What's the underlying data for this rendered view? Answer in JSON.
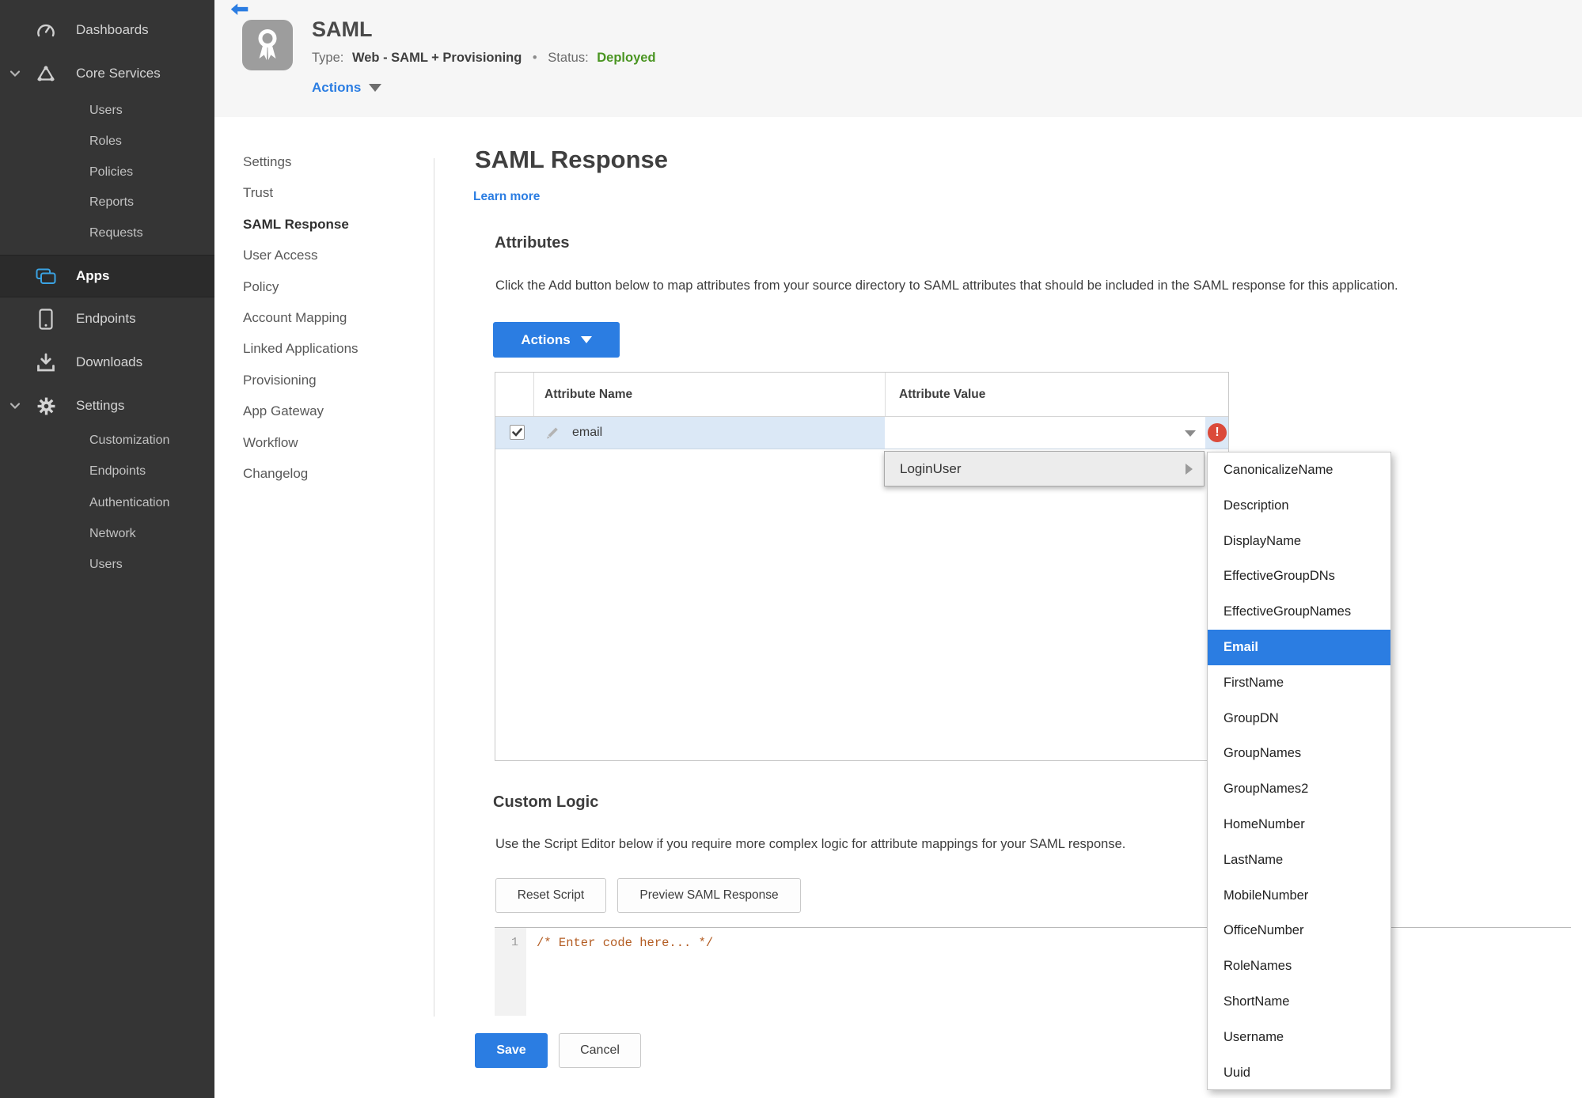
{
  "colors": {
    "accent_blue": "#2b7de2",
    "apps_icon_blue": "#3aa3e3",
    "status_green": "#4a9522",
    "error_red": "#db4a3a",
    "row_highlight": "#dbe8f6",
    "sidebar_bg": "#353535",
    "header_bg": "#f6f6f6",
    "code_comment_color": "#b35c22"
  },
  "icons": {
    "back": "back-arrow-icon",
    "app": "ribbon-badge-icon",
    "dashboards": "gauge-icon",
    "core_services": "network-triangle-icon",
    "apps": "stacked-windows-icon",
    "endpoints": "mobile-device-icon",
    "downloads": "download-tray-icon",
    "settings": "gear-icon",
    "row_edit": "pencil-icon",
    "error": "exclamation-circle-icon"
  },
  "sidebar": {
    "items": {
      "dashboards": {
        "label": "Dashboards"
      },
      "core_services": {
        "label": "Core Services",
        "children": [
          "Users",
          "Roles",
          "Policies",
          "Reports",
          "Requests"
        ]
      },
      "apps": {
        "label": "Apps",
        "active": true
      },
      "endpoints": {
        "label": "Endpoints"
      },
      "downloads": {
        "label": "Downloads"
      },
      "settings": {
        "label": "Settings",
        "children": [
          "Customization",
          "Endpoints",
          "Authentication",
          "Network",
          "Users"
        ]
      }
    }
  },
  "header": {
    "app_title": "SAML",
    "type_label": "Type:",
    "type_value": "Web - SAML + Provisioning",
    "separator": "•",
    "status_label": "Status:",
    "status_value": "Deployed",
    "actions_label": "Actions"
  },
  "app_nav": {
    "items": [
      {
        "label": "Settings"
      },
      {
        "label": "Trust"
      },
      {
        "label": "SAML Response",
        "state": "active"
      },
      {
        "label": "User Access"
      },
      {
        "label": "Policy"
      },
      {
        "label": "Account Mapping"
      },
      {
        "label": "Linked Applications"
      },
      {
        "label": "Provisioning"
      },
      {
        "label": "App Gateway"
      },
      {
        "label": "Workflow"
      },
      {
        "label": "Changelog"
      }
    ]
  },
  "main": {
    "title": "SAML Response",
    "learn_more": "Learn more",
    "attributes": {
      "heading": "Attributes",
      "description": "Click the Add button below to map attributes from your source directory to SAML attributes that should be included in the SAML response for this application.",
      "actions_button": "Actions",
      "table": {
        "columns": [
          "Attribute Name",
          "Attribute Value"
        ],
        "rows": [
          {
            "name": "email",
            "value": "",
            "checked": true,
            "error_glyph": "!"
          }
        ]
      }
    },
    "context_menu": {
      "parent": "LoginUser",
      "items": [
        {
          "label": "CanonicalizeName"
        },
        {
          "label": "Description"
        },
        {
          "label": "DisplayName"
        },
        {
          "label": "EffectiveGroupDNs"
        },
        {
          "label": "EffectiveGroupNames"
        },
        {
          "label": "Email",
          "state": "selected"
        },
        {
          "label": "FirstName"
        },
        {
          "label": "GroupDN"
        },
        {
          "label": "GroupNames"
        },
        {
          "label": "GroupNames2"
        },
        {
          "label": "HomeNumber"
        },
        {
          "label": "LastName"
        },
        {
          "label": "MobileNumber"
        },
        {
          "label": "OfficeNumber"
        },
        {
          "label": "RoleNames"
        },
        {
          "label": "ShortName"
        },
        {
          "label": "Username"
        },
        {
          "label": "Uuid"
        }
      ]
    },
    "custom_logic": {
      "heading": "Custom Logic",
      "description": "Use the Script Editor below if you require more complex logic for attribute mappings for your SAML response.",
      "reset_button": "Reset Script",
      "preview_button": "Preview SAML Response",
      "editor": {
        "line_number": "1",
        "code": "/* Enter code here... */"
      }
    },
    "footer": {
      "save": "Save",
      "cancel": "Cancel"
    }
  }
}
